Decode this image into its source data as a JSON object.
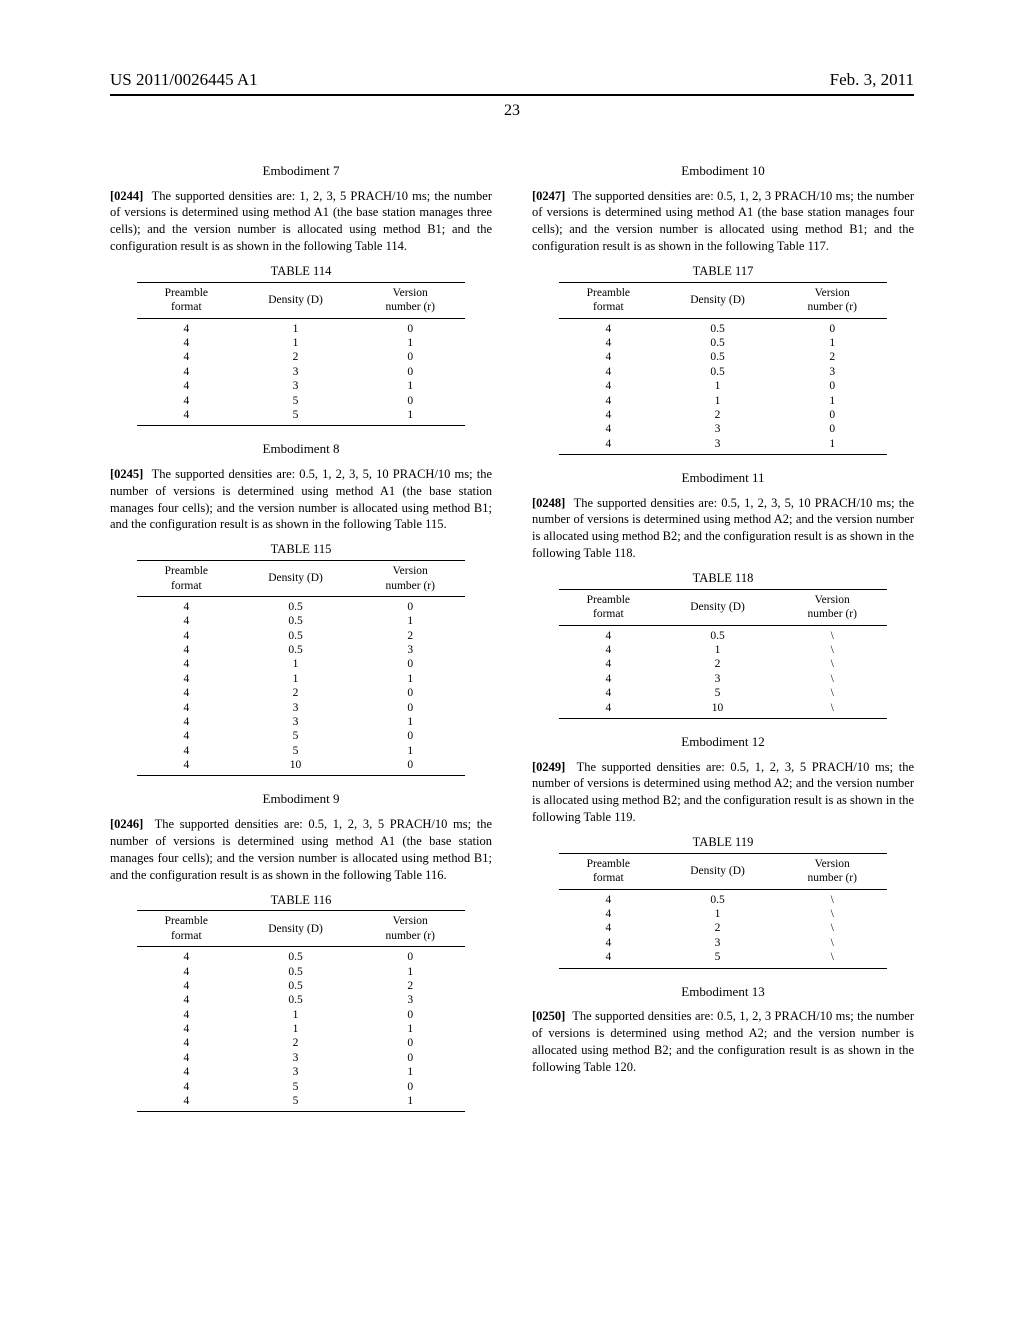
{
  "header": {
    "left": "US 2011/0026445 A1",
    "right": "Feb. 3, 2011",
    "page": "23"
  },
  "emb7": {
    "heading": "Embodiment 7",
    "pnum": "[0244]",
    "text": "The supported densities are: 1, 2, 3, 5 PRACH/10 ms; the number of versions is determined using method A1 (the base station manages three cells); and the version number is allocated using method B1; and the configuration result is as shown in the following Table 114."
  },
  "tbl114": {
    "caption": "TABLE 114",
    "h1": "Preamble\nformat",
    "h2": "Density (D)",
    "h3": "Version\nnumber (r)",
    "rows": [
      {
        "c1": "4",
        "c2": "1",
        "c3": "0"
      },
      {
        "c1": "4",
        "c2": "1",
        "c3": "1"
      },
      {
        "c1": "4",
        "c2": "2",
        "c3": "0"
      },
      {
        "c1": "4",
        "c2": "3",
        "c3": "0"
      },
      {
        "c1": "4",
        "c2": "3",
        "c3": "1"
      },
      {
        "c1": "4",
        "c2": "5",
        "c3": "0"
      },
      {
        "c1": "4",
        "c2": "5",
        "c3": "1"
      }
    ]
  },
  "emb8": {
    "heading": "Embodiment 8",
    "pnum": "[0245]",
    "text": "The supported densities are: 0.5, 1, 2, 3, 5, 10 PRACH/10 ms; the number of versions is determined using method A1 (the base station manages four cells); and the version number is allocated using method B1; and the configuration result is as shown in the following Table 115."
  },
  "tbl115": {
    "caption": "TABLE 115",
    "h1": "Preamble\nformat",
    "h2": "Density (D)",
    "h3": "Version\nnumber (r)",
    "rows": [
      {
        "c1": "4",
        "c2": "0.5",
        "c3": "0"
      },
      {
        "c1": "4",
        "c2": "0.5",
        "c3": "1"
      },
      {
        "c1": "4",
        "c2": "0.5",
        "c3": "2"
      },
      {
        "c1": "4",
        "c2": "0.5",
        "c3": "3"
      },
      {
        "c1": "4",
        "c2": "1",
        "c3": "0"
      },
      {
        "c1": "4",
        "c2": "1",
        "c3": "1"
      },
      {
        "c1": "4",
        "c2": "2",
        "c3": "0"
      },
      {
        "c1": "4",
        "c2": "3",
        "c3": "0"
      },
      {
        "c1": "4",
        "c2": "3",
        "c3": "1"
      },
      {
        "c1": "4",
        "c2": "5",
        "c3": "0"
      },
      {
        "c1": "4",
        "c2": "5",
        "c3": "1"
      },
      {
        "c1": "4",
        "c2": "10",
        "c3": "0"
      }
    ]
  },
  "emb9": {
    "heading": "Embodiment 9",
    "pnum": "[0246]",
    "text": "The supported densities are: 0.5, 1, 2, 3, 5 PRACH/10 ms; the number of versions is determined using method A1 (the base station manages four cells); and the version number is allocated using method B1; and the configuration result is as shown in the following Table 116."
  },
  "tbl116": {
    "caption": "TABLE 116",
    "h1": "Preamble\nformat",
    "h2": "Density (D)",
    "h3": "Version\nnumber (r)",
    "rows": [
      {
        "c1": "4",
        "c2": "0.5",
        "c3": "0"
      },
      {
        "c1": "4",
        "c2": "0.5",
        "c3": "1"
      },
      {
        "c1": "4",
        "c2": "0.5",
        "c3": "2"
      },
      {
        "c1": "4",
        "c2": "0.5",
        "c3": "3"
      },
      {
        "c1": "4",
        "c2": "1",
        "c3": "0"
      },
      {
        "c1": "4",
        "c2": "1",
        "c3": "1"
      },
      {
        "c1": "4",
        "c2": "2",
        "c3": "0"
      },
      {
        "c1": "4",
        "c2": "3",
        "c3": "0"
      },
      {
        "c1": "4",
        "c2": "3",
        "c3": "1"
      },
      {
        "c1": "4",
        "c2": "5",
        "c3": "0"
      },
      {
        "c1": "4",
        "c2": "5",
        "c3": "1"
      }
    ]
  },
  "emb10": {
    "heading": "Embodiment 10",
    "pnum": "[0247]",
    "text": "The supported densities are: 0.5, 1, 2, 3 PRACH/10 ms; the number of versions is determined using method A1 (the base station manages four cells); and the version number is allocated using method B1; and the configuration result is as shown in the following Table 117."
  },
  "tbl117": {
    "caption": "TABLE 117",
    "h1": "Preamble\nformat",
    "h2": "Density (D)",
    "h3": "Version\nnumber (r)",
    "rows": [
      {
        "c1": "4",
        "c2": "0.5",
        "c3": "0"
      },
      {
        "c1": "4",
        "c2": "0.5",
        "c3": "1"
      },
      {
        "c1": "4",
        "c2": "0.5",
        "c3": "2"
      },
      {
        "c1": "4",
        "c2": "0.5",
        "c3": "3"
      },
      {
        "c1": "4",
        "c2": "1",
        "c3": "0"
      },
      {
        "c1": "4",
        "c2": "1",
        "c3": "1"
      },
      {
        "c1": "4",
        "c2": "2",
        "c3": "0"
      },
      {
        "c1": "4",
        "c2": "3",
        "c3": "0"
      },
      {
        "c1": "4",
        "c2": "3",
        "c3": "1"
      }
    ]
  },
  "emb11": {
    "heading": "Embodiment 11",
    "pnum": "[0248]",
    "text": "The supported densities are: 0.5, 1, 2, 3, 5, 10 PRACH/10 ms; the number of versions is determined using method A2; and the version number is allocated using method B2; and the configuration result is as shown in the following Table 118."
  },
  "tbl118": {
    "caption": "TABLE 118",
    "h1": "Preamble\nformat",
    "h2": "Density (D)",
    "h3": "Version\nnumber (r)",
    "rows": [
      {
        "c1": "4",
        "c2": "0.5",
        "c3": "\\"
      },
      {
        "c1": "4",
        "c2": "1",
        "c3": "\\"
      },
      {
        "c1": "4",
        "c2": "2",
        "c3": "\\"
      },
      {
        "c1": "4",
        "c2": "3",
        "c3": "\\"
      },
      {
        "c1": "4",
        "c2": "5",
        "c3": "\\"
      },
      {
        "c1": "4",
        "c2": "10",
        "c3": "\\"
      }
    ]
  },
  "emb12": {
    "heading": "Embodiment 12",
    "pnum": "[0249]",
    "text": "The supported densities are: 0.5, 1, 2, 3, 5 PRACH/10 ms; the number of versions is determined using method A2; and the version number is allocated using method B2; and the configuration result is as shown in the following Table 119."
  },
  "tbl119": {
    "caption": "TABLE 119",
    "h1": "Preamble\nformat",
    "h2": "Density (D)",
    "h3": "Version\nnumber (r)",
    "rows": [
      {
        "c1": "4",
        "c2": "0.5",
        "c3": "\\"
      },
      {
        "c1": "4",
        "c2": "1",
        "c3": "\\"
      },
      {
        "c1": "4",
        "c2": "2",
        "c3": "\\"
      },
      {
        "c1": "4",
        "c2": "3",
        "c3": "\\"
      },
      {
        "c1": "4",
        "c2": "5",
        "c3": "\\"
      }
    ]
  },
  "emb13": {
    "heading": "Embodiment 13",
    "pnum": "[0250]",
    "text": "The supported densities are: 0.5, 1, 2, 3 PRACH/10 ms; the number of versions is determined using method A2; and the version number is allocated using method B2; and the configuration result is as shown in the following Table 120."
  }
}
